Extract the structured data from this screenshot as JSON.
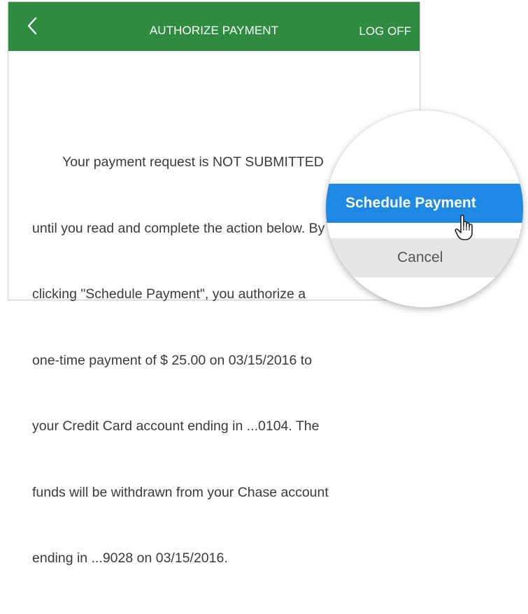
{
  "header": {
    "title": "AUTHORIZE PAYMENT",
    "logoff_label": "LOG OFF",
    "back_icon": "chevron-left-icon",
    "background_color": "#2e8b3f"
  },
  "message": {
    "lines": [
      "        Your payment request is NOT SUBMITTED",
      "until you read and complete the action below. By",
      "clicking \"Schedule Payment\", you authorize a",
      "one-time payment of $ 25.00 on 03/15/2016 to",
      "your Credit Card account ending in ...0104. The",
      "funds will be withdrawn from your Chase account",
      "ending in ...9028 on 03/15/2016."
    ]
  },
  "magnifier": {
    "primary_button_label": "Schedule Payment",
    "primary_button_color": "#1e88e5",
    "cancel_button_label": "Cancel",
    "cursor_icon": "hand-pointer-icon"
  }
}
